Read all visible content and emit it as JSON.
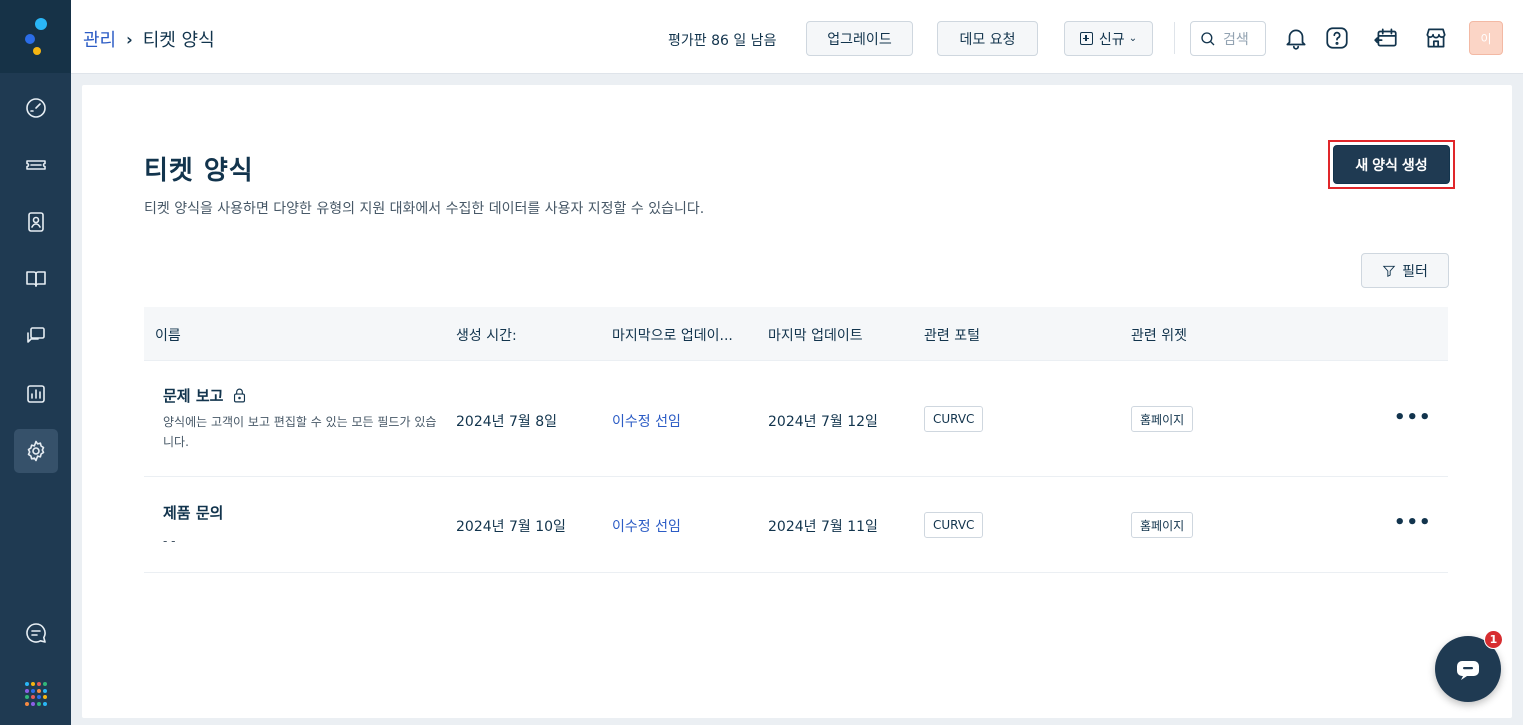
{
  "breadcrumb": {
    "parent": "관리",
    "separator": "›",
    "current": "티켓 양식"
  },
  "topbar": {
    "trial_text": "평가판 86 일 남음",
    "upgrade_label": "업그레이드",
    "demo_label": "데모 요청",
    "new_label": "신규",
    "search_placeholder": "검색",
    "avatar_initial": "이"
  },
  "page": {
    "title": "티켓 양식",
    "description": "티켓 양식을 사용하면 다양한 유형의 지원 대화에서 수집한 데이터를 사용자 지정할 수 있습니다.",
    "create_button": "새 양식 생성",
    "filter_button": "필터"
  },
  "table": {
    "columns": [
      "이름",
      "생성 시간:",
      "마지막으로 업데이...",
      "마지막 업데이트",
      "관련 포털",
      "관련 위젯"
    ],
    "rows": [
      {
        "name": "문제 보고",
        "description": "양식에는 고객이 보고 편집할 수 있는 모든 필드가 있습니다.",
        "created": "2024년 7월 8일",
        "updated_by": "이수정 선임",
        "last_updated": "2024년 7월 12일",
        "portal": "CURVC",
        "widget": "홈페이지",
        "more": "•••"
      },
      {
        "name": "제품 문의",
        "description": "- -",
        "created": "2024년 7월 10일",
        "updated_by": "이수정 선임",
        "last_updated": "2024년 7월 11일",
        "portal": "CURVC",
        "widget": "홈페이지",
        "more": "•••"
      }
    ]
  },
  "chat": {
    "badge_count": "1"
  },
  "colors": {
    "sidebar": "#1f3a52",
    "primary_button": "#1f3a52",
    "link": "#2c5cc5",
    "highlight": "#e0262a",
    "badge": "#d72d30"
  }
}
